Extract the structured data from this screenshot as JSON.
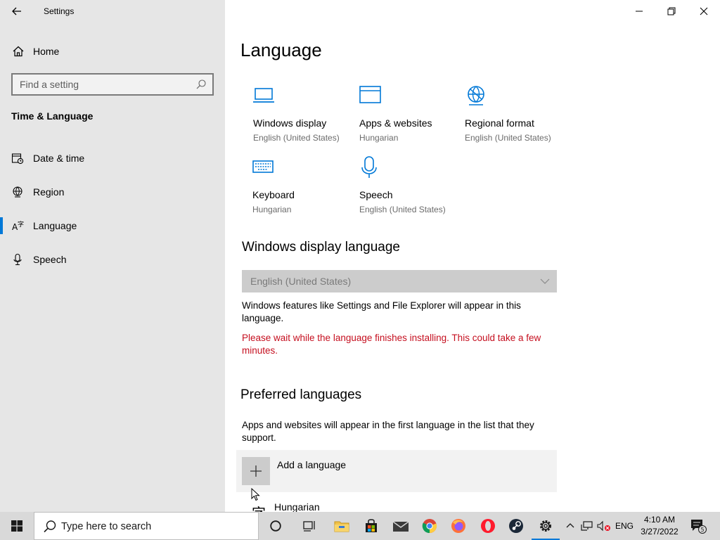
{
  "window": {
    "title": "Settings"
  },
  "sidebar": {
    "home_label": "Home",
    "search_placeholder": "Find a setting",
    "section_title": "Time & Language",
    "items": [
      {
        "label": "Date & time",
        "icon": "date-time-icon"
      },
      {
        "label": "Region",
        "icon": "globe-icon"
      },
      {
        "label": "Language",
        "icon": "language-icon",
        "selected": true
      },
      {
        "label": "Speech",
        "icon": "microphone-icon"
      }
    ]
  },
  "main": {
    "title": "Language",
    "tiles": [
      {
        "label": "Windows display",
        "sub": "English (United States)",
        "icon": "monitor-icon"
      },
      {
        "label": "Apps & websites",
        "sub": "Hungarian",
        "icon": "browser-window-icon"
      },
      {
        "label": "Regional format",
        "sub": "English (United States)",
        "icon": "globe-icon"
      },
      {
        "label": "Keyboard",
        "sub": "Hungarian",
        "icon": "keyboard-icon"
      },
      {
        "label": "Speech",
        "sub": "English (United States)",
        "icon": "microphone-icon"
      }
    ],
    "display_language": {
      "heading": "Windows display language",
      "selected": "English (United States)",
      "description": "Windows features like Settings and File Explorer will appear in this language.",
      "warning": "Please wait while the language finishes installing. This could take a few minutes."
    },
    "preferred": {
      "heading": "Preferred languages",
      "description": "Apps and websites will appear in the first language in the list that they support.",
      "add_label": "Add a language",
      "languages": [
        {
          "name": "Hungarian",
          "glyph": "字"
        }
      ]
    }
  },
  "taskbar": {
    "search_placeholder": "Type here to search",
    "apps": [
      "cortana-icon",
      "task-view-icon",
      "file-explorer-icon",
      "store-icon",
      "mail-icon",
      "chrome-icon",
      "firefox-icon",
      "opera-icon",
      "steam-icon",
      "settings-icon"
    ],
    "input_language": "ENG",
    "time": "4:10 AM",
    "date": "3/27/2022",
    "notification_count": "5"
  },
  "colors": {
    "accent": "#0078d7",
    "warning": "#c50f1f",
    "sidebar_bg": "#e6e6e6"
  }
}
